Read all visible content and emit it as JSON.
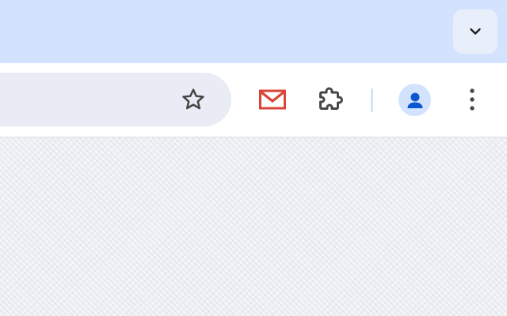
{
  "tabstrip": {
    "tab_search_icon": "chevron-down-icon"
  },
  "toolbar": {
    "bookmark_icon": "star-outline-icon",
    "extension_icon": "gmail-icon",
    "extensions_menu_icon": "puzzle-piece-icon",
    "profile_icon": "person-icon",
    "menu_icon": "vertical-dots-icon"
  },
  "colors": {
    "tabstrip_bg": "#d3e3fd",
    "toolbar_bg": "#ffffff",
    "omnibox_bg": "#e9ecf4",
    "gmail_red": "#db4437",
    "profile_blue": "#0b57d0",
    "icon_gray": "#474747"
  }
}
